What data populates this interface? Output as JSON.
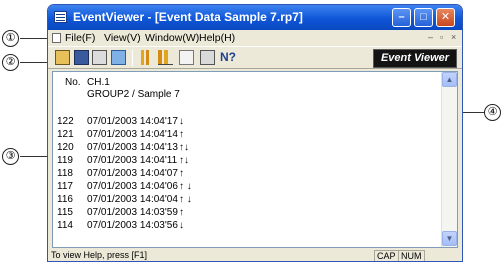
{
  "window": {
    "title": "EventViewer - [Event Data Sample 7.rp7]",
    "minimize_glyph": "–",
    "maximize_glyph": "□",
    "close_glyph": "✕"
  },
  "menu": {
    "items": [
      "File(F)",
      "View(V)",
      "Window(W)",
      "Help(H)"
    ],
    "mdi_controls": [
      "–",
      "▫",
      "×"
    ]
  },
  "toolbar": {
    "badge": "Event Viewer",
    "help_glyph": "N?"
  },
  "list": {
    "header_no": "No.",
    "header_ch": "CH.1",
    "group": "GROUP2  / Sample 7",
    "rows": [
      {
        "no": "122",
        "time": "07/01/2003 14:04'17",
        "arrows": "↓"
      },
      {
        "no": "121",
        "time": "07/01/2003 14:04'14",
        "arrows": "↑"
      },
      {
        "no": "120",
        "time": "07/01/2003 14:04'13",
        "arrows": "↑↓"
      },
      {
        "no": "119",
        "time": "07/01/2003 14:04'11",
        "arrows": "↑↓"
      },
      {
        "no": "118",
        "time": "07/01/2003 14:04'07",
        "arrows": "↑"
      },
      {
        "no": "117",
        "time": "07/01/2003 14:04'06",
        "arrows": "↑ ↓"
      },
      {
        "no": "116",
        "time": "07/01/2003 14:04'04",
        "arrows": "↑ ↓"
      },
      {
        "no": "115",
        "time": "07/01/2003 14:03'59",
        "arrows": "↑"
      },
      {
        "no": "114",
        "time": "07/01/2003 14:03'56",
        "arrows": "↓"
      }
    ]
  },
  "status": {
    "message": "To view Help, press [F1]",
    "cap": "CAP",
    "num": "NUM"
  },
  "callouts": [
    "①",
    "②",
    "③",
    "④"
  ]
}
